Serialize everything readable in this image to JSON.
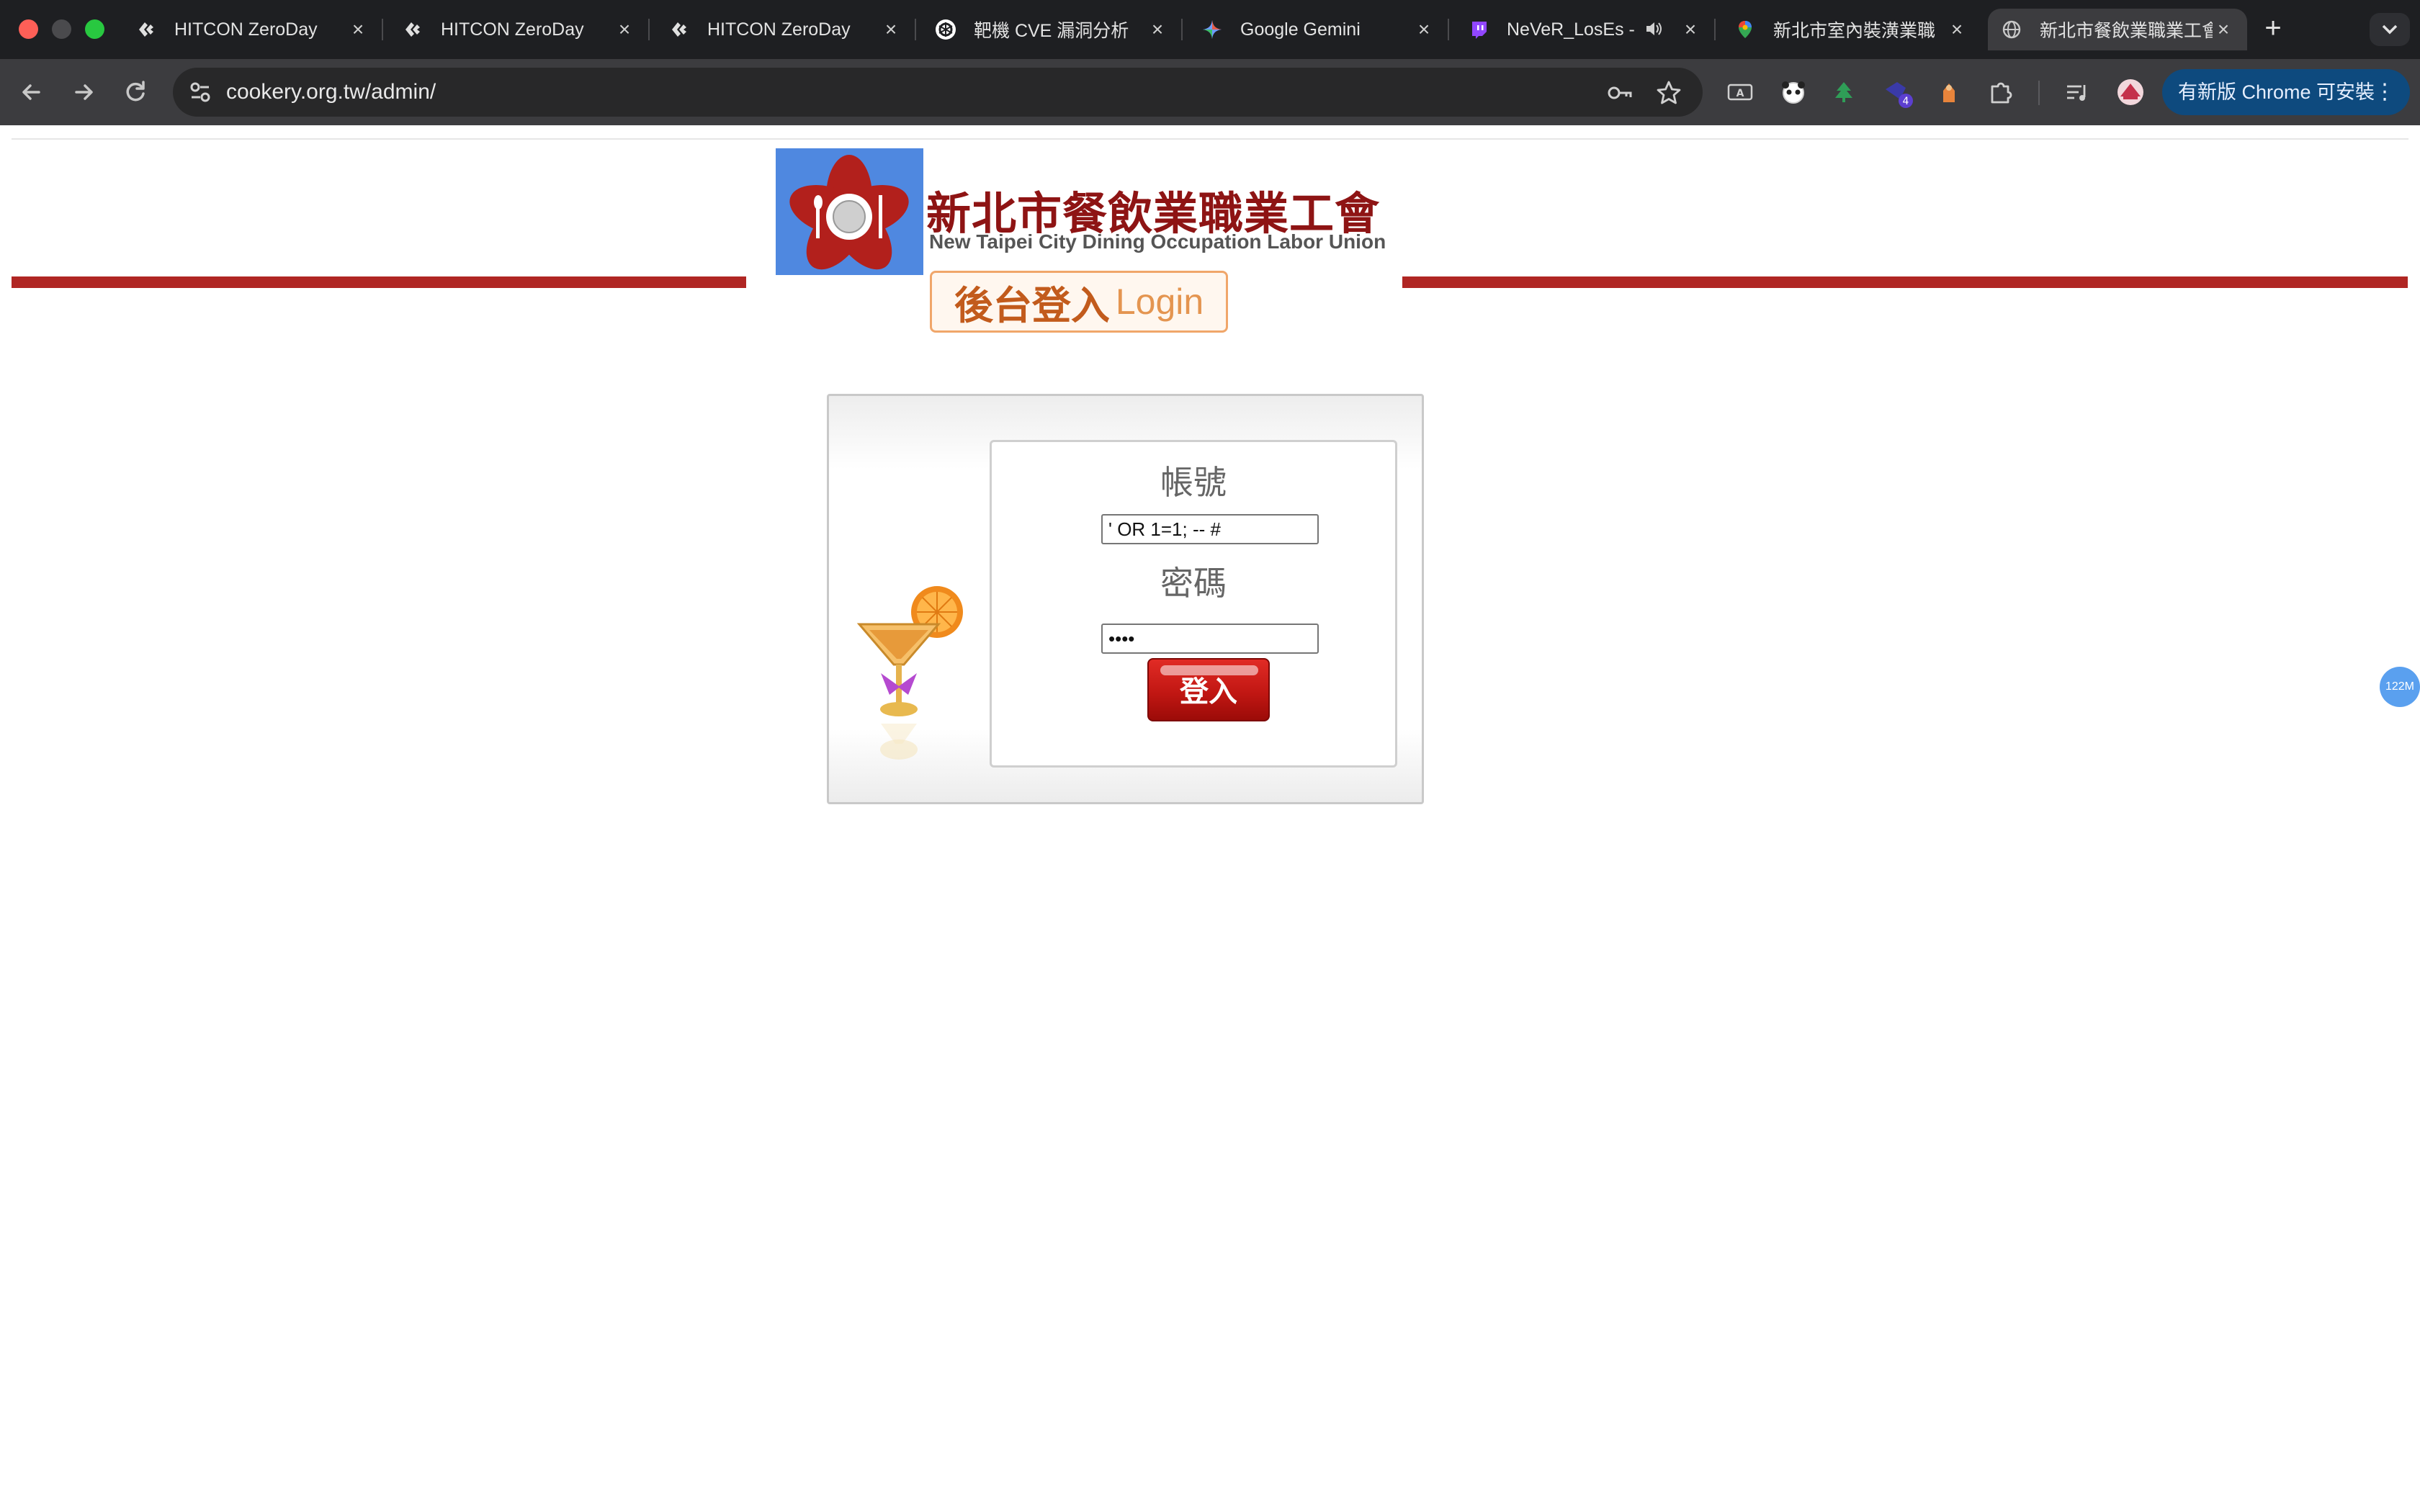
{
  "browser": {
    "tabs": [
      {
        "title": "HITCON ZeroDay",
        "icon": "hitcon-icon"
      },
      {
        "title": "HITCON ZeroDay",
        "icon": "hitcon-icon"
      },
      {
        "title": "HITCON ZeroDay",
        "icon": "hitcon-icon"
      },
      {
        "title": "靶機 CVE 漏洞分析",
        "icon": "chatgpt-icon"
      },
      {
        "title": "Google Gemini",
        "icon": "gemini-icon"
      },
      {
        "title": "NeVeR_LosEs -",
        "icon": "twitch-icon"
      },
      {
        "title": "新北市室內裝潢業職",
        "icon": "maps-pin-icon"
      },
      {
        "title": "新北市餐飲業職業工會",
        "icon": "globe-icon"
      }
    ],
    "active_tab_index": 7,
    "url": "cookery.org.tw/admin/",
    "update_button_label": "有新版 Chrome 可安裝",
    "extension_badge_count": "4",
    "accent_color": "#0e4a7e"
  },
  "page": {
    "org_name_cn": "新北市餐飲業職業工會",
    "org_name_en": "New Taipei City Dining Occupation Labor Union",
    "login_banner_cn": "後台登入",
    "login_banner_en": "Login",
    "login_form": {
      "username_label": "帳號",
      "username_value": "' OR 1=1; -- #",
      "password_label": "密碼",
      "password_value": "••••",
      "submit_label": "登入"
    },
    "floating_badge": "122M",
    "brand_red": "#b02623"
  }
}
